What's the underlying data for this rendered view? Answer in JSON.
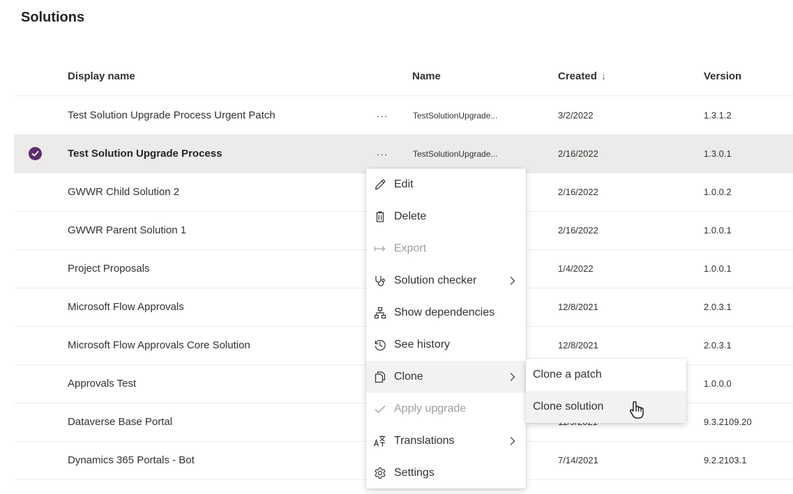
{
  "page": {
    "title": "Solutions"
  },
  "table": {
    "columns": {
      "display_name": "Display name",
      "name": "Name",
      "created": "Created",
      "created_sort_indicator": "↓",
      "version": "Version"
    },
    "rows": [
      {
        "display_name": "Test Solution Upgrade Process Urgent Patch",
        "more": "···",
        "name": "TestSolutionUpgrade...",
        "created": "3/2/2022",
        "version": "1.3.1.2"
      },
      {
        "display_name": "Test Solution Upgrade Process",
        "more": "···",
        "name": "TestSolutionUpgrade...",
        "created": "2/16/2022",
        "version": "1.3.0.1",
        "selected": true
      },
      {
        "display_name": "GWWR Child Solution 2",
        "created": "2/16/2022",
        "version": "1.0.0.2"
      },
      {
        "display_name": "GWWR Parent Solution 1",
        "created": "2/16/2022",
        "version": "1.0.0.1"
      },
      {
        "display_name": "Project Proposals",
        "created": "1/4/2022",
        "version": "1.0.0.1"
      },
      {
        "display_name": "Microsoft Flow Approvals",
        "created": "12/8/2021",
        "version": "2.0.3.1"
      },
      {
        "display_name": "Microsoft Flow Approvals Core Solution",
        "created": "12/8/2021",
        "version": "2.0.3.1"
      },
      {
        "display_name": "Approvals Test",
        "created": "",
        "version": "1.0.0.0"
      },
      {
        "display_name": "Dataverse Base Portal",
        "created": "11/9/2021",
        "version": "9.3.2109.20"
      },
      {
        "display_name": "Dynamics 365 Portals - Bot",
        "created": "7/14/2021",
        "version": "9.2.2103.1"
      }
    ]
  },
  "context_menu": {
    "items": [
      {
        "label": "Edit",
        "icon": "pencil-icon",
        "disabled": false
      },
      {
        "label": "Delete",
        "icon": "trash-icon",
        "disabled": false
      },
      {
        "label": "Export",
        "icon": "export-arrow-icon",
        "disabled": true
      },
      {
        "label": "Solution checker",
        "icon": "stethoscope-icon",
        "disabled": false,
        "has_submenu": true
      },
      {
        "label": "Show dependencies",
        "icon": "hierarchy-icon",
        "disabled": false
      },
      {
        "label": "See history",
        "icon": "history-icon",
        "disabled": false
      },
      {
        "label": "Clone",
        "icon": "copy-icon",
        "disabled": false,
        "has_submenu": true,
        "active": true
      },
      {
        "label": "Apply upgrade",
        "icon": "checkmark-icon",
        "disabled": true
      },
      {
        "label": "Translations",
        "icon": "translate-icon",
        "disabled": false,
        "has_submenu": true
      },
      {
        "label": "Settings",
        "icon": "gear-icon",
        "disabled": false
      }
    ]
  },
  "clone_submenu": {
    "items": [
      {
        "label": "Clone a patch"
      },
      {
        "label": "Clone solution",
        "hovered": true
      }
    ]
  },
  "colors": {
    "selected_check": "#5c2d6e",
    "selected_row_bg": "#edebe9",
    "menu_hover_bg": "#f3f2f1",
    "disabled_text": "#a19f9d"
  }
}
